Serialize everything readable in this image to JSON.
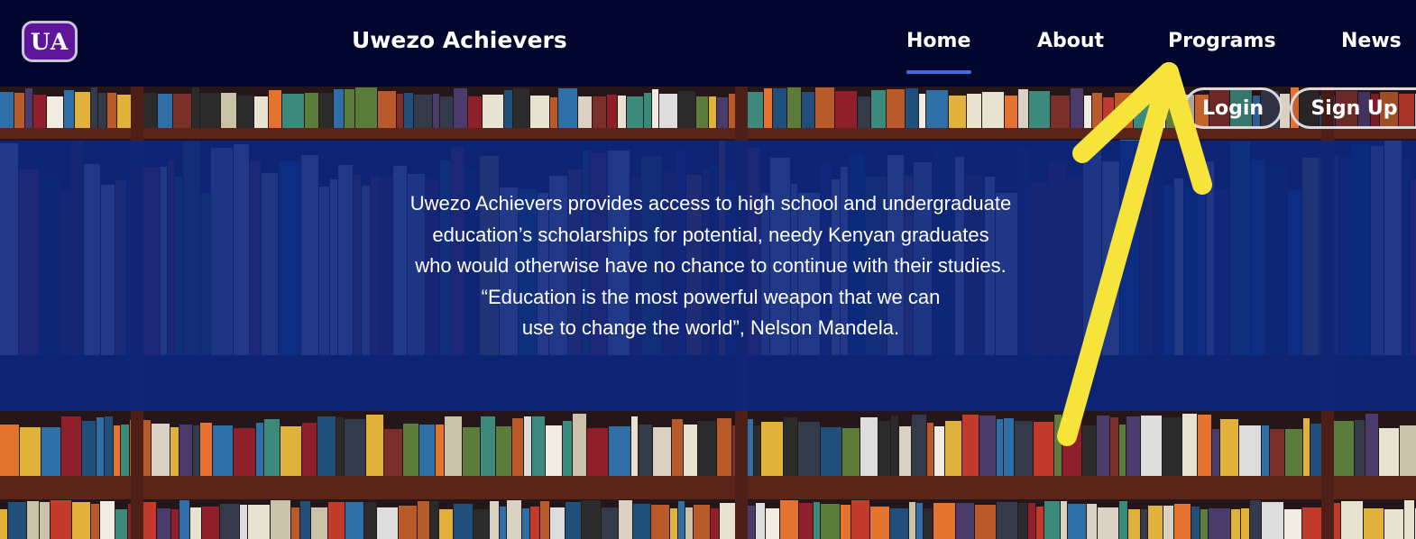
{
  "header": {
    "logo_text": "UA",
    "brand": "Uwezo Achievers",
    "nav": {
      "home": "Home",
      "about": "About",
      "programs": "Programs",
      "news": "News"
    },
    "active_nav": "home",
    "accent_color": "#3f6ee6",
    "background_color": "#03072f"
  },
  "hero": {
    "lines": [
      "Uwezo Achievers provides access to high school and undergraduate",
      "education’s scholarships for potential, needy Kenyan graduates",
      "who would otherwise have no chance to continue with their studies.",
      "“Education is the most powerful weapon that we can",
      "use to change the world”, Nelson Mandela."
    ],
    "overlay_color": "#0a267d"
  },
  "auth": {
    "login": "Login",
    "signup": "Sign Up"
  },
  "annotation": {
    "type": "arrow",
    "color": "#f7e43a",
    "points_to": "nav-programs"
  }
}
